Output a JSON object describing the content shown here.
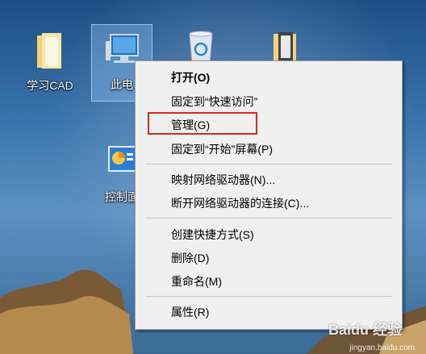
{
  "desktop": {
    "icons": [
      {
        "label": "学习CAD",
        "icon": "folder-icon"
      },
      {
        "label": "此电",
        "icon": "computer-icon"
      },
      {
        "label": "",
        "icon": "recycle-bin-icon"
      },
      {
        "label": "",
        "icon": "document-folder-icon"
      },
      {
        "label": "控制面",
        "icon": "control-panel-icon"
      }
    ]
  },
  "context_menu": {
    "items": [
      {
        "label": "打开(O)",
        "bold": true
      },
      {
        "label": "固定到“快速访问”"
      },
      {
        "label": "管理(G)",
        "highlighted": true
      },
      {
        "label": "固定到“开始”屏幕(P)"
      },
      {
        "label": "映射网络驱动器(N)..."
      },
      {
        "label": "断开网络驱动器的连接(C)..."
      },
      {
        "label": "创建快捷方式(S)"
      },
      {
        "label": "删除(D)"
      },
      {
        "label": "重命名(M)"
      },
      {
        "label": "属性(R)"
      }
    ],
    "highlight_color": "#d62828"
  },
  "watermark": {
    "brand": "Baidu 经验",
    "url": "jingyan.baidu.com"
  }
}
